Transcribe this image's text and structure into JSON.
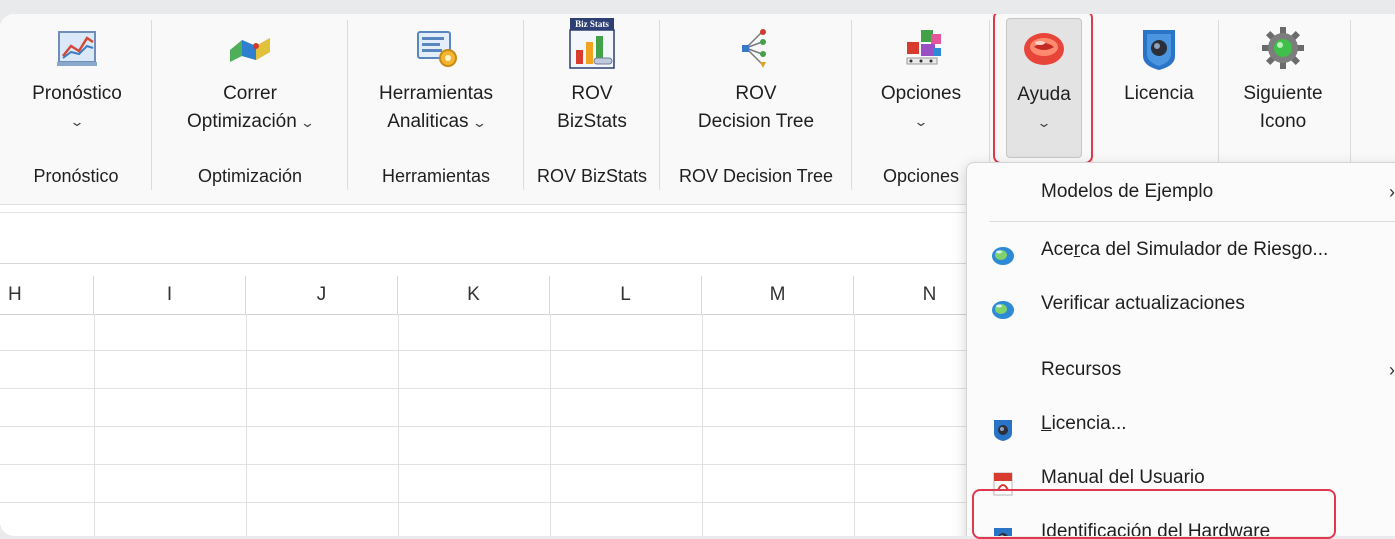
{
  "ribbon": {
    "groups": [
      {
        "id": "pronostico",
        "buttons": [
          {
            "line1": "Pronóstico",
            "line2": "",
            "dropdown": true
          }
        ],
        "label": "Pronóstico"
      },
      {
        "id": "optimizacion",
        "buttons": [
          {
            "line1": "Correr",
            "line2": "Optimización",
            "dropdown": true
          }
        ],
        "label": "Optimización"
      },
      {
        "id": "herramientas",
        "buttons": [
          {
            "line1": "Herramientas",
            "line2": "Analiticas",
            "dropdown": true
          }
        ],
        "label": "Herramientas"
      },
      {
        "id": "bizstats",
        "buttons": [
          {
            "line1": "ROV",
            "line2": "BizStats",
            "dropdown": false
          }
        ],
        "label": "ROV BizStats"
      },
      {
        "id": "decisiontree",
        "buttons": [
          {
            "line1": "ROV",
            "line2": "Decision Tree",
            "dropdown": false
          }
        ],
        "label": "ROV Decision Tree"
      },
      {
        "id": "opciones",
        "buttons": [
          {
            "line1": "Opciones",
            "line2": "",
            "dropdown": true
          }
        ],
        "label": "Opciones"
      },
      {
        "id": "ayuda",
        "buttons": [
          {
            "line1": "Ayuda",
            "line2": "",
            "dropdown": true
          },
          {
            "line1": "Licencia",
            "line2": "",
            "dropdown": false
          },
          {
            "line1": "Siguiente",
            "line2": "Icono",
            "dropdown": false
          }
        ],
        "label": ""
      }
    ],
    "bizstats_icon_text": "Biz Stats",
    "chevron": "⌄"
  },
  "grid": {
    "columns": [
      "H",
      "I",
      "J",
      "K",
      "L",
      "M",
      "N"
    ]
  },
  "menu": {
    "items": [
      {
        "label": "Modelos de Ejemplo",
        "icon": "none",
        "submenu": true
      },
      {
        "label_pre": "Ace",
        "label_u": "r",
        "label_post": "ca del Simulador de Riesgo...",
        "icon": "globe-icon",
        "submenu": false
      },
      {
        "label": "Verificar actualizaciones",
        "icon": "globe-icon",
        "submenu": false
      },
      {
        "label": "Recursos",
        "icon": "none",
        "submenu": true
      },
      {
        "label_u": "L",
        "label_post": "icencia...",
        "icon": "license-icon",
        "submenu": false
      },
      {
        "label": "Manual del Usuario",
        "icon": "pdf-icon",
        "submenu": false
      },
      {
        "label": "Identificación del Hardware",
        "icon": "license-icon",
        "submenu": false
      }
    ],
    "submenu_arrow": "›"
  },
  "colors": {
    "highlight": "#e0384c",
    "ribbon_bg": "#f9f9f9",
    "menu_bg": "#fbfbfb"
  }
}
